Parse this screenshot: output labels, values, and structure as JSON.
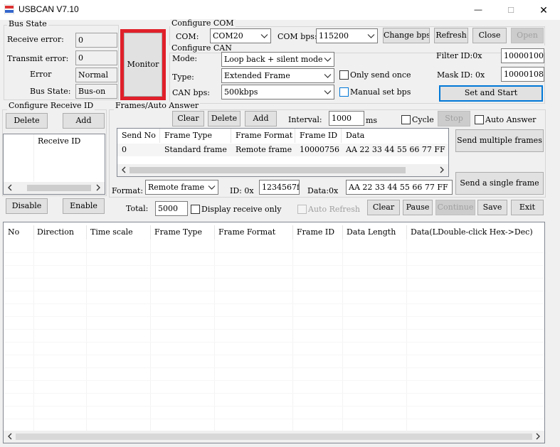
{
  "window": {
    "title": "USBCAN V7.10",
    "controls": {
      "minimize": "—",
      "maximize": "☐",
      "close": "✕"
    }
  },
  "bus_state": {
    "group_title": "Bus State",
    "receive_error_label": "Receive error:",
    "receive_error_value": "0",
    "transmit_error_label": "Transmit error:",
    "transmit_error_value": "0",
    "error_label": "Error",
    "error_value": "Normal",
    "bus_state_label": "Bus State:",
    "bus_state_value": "Bus-on"
  },
  "monitor_button": {
    "label": "Monitor",
    "highlight_color": "#e0202a"
  },
  "configure_com": {
    "group_title": "Configure COM",
    "com_label": "COM:",
    "com_value": "COM20",
    "bps_label": "COM bps:",
    "bps_value": "115200",
    "change_bps": "Change bps",
    "refresh": "Refresh",
    "close": "Close",
    "open": "Open"
  },
  "configure_can": {
    "group_title": "Configure CAN",
    "mode_label": "Mode:",
    "mode_value": "Loop back + silent mode",
    "type_label": "Type:",
    "type_value": "Extended Frame",
    "only_send_once": "Only send once",
    "bps_label": "CAN bps:",
    "bps_value": "500kbps",
    "manual_set_bps": "Manual set bps",
    "filter_label": "Filter ID:0x",
    "filter_value": "10000100",
    "mask_label": "Mask ID:  0x",
    "mask_value": "10000108",
    "set_and_start": "Set and Start"
  },
  "receive_id": {
    "group_title": "Configure Receive ID",
    "delete": "Delete",
    "add": "Add",
    "column": "Receive ID",
    "disable": "Disable",
    "enable": "Enable"
  },
  "frames": {
    "group_title": "Frames/Auto Answer",
    "clear": "Clear",
    "delete": "Delete",
    "add": "Add",
    "interval_label": "Interval:",
    "interval_value": "1000",
    "interval_unit": "ms",
    "cycle": "Cycle",
    "stop": "Stop",
    "auto_answer": "Auto Answer",
    "columns": [
      "Send No",
      "Frame Type",
      "Frame Format",
      "Frame ID",
      "Data"
    ],
    "rows": [
      [
        "0",
        "Standard frame",
        "Remote frame",
        "10000756",
        "AA 22 33 44 55 66 77 FF"
      ]
    ],
    "send_multiple": "Send multiple frames",
    "send_single": "Send a single frame",
    "format_label": "Format:",
    "format_value": "Remote frame",
    "id_label": "ID: 0x",
    "id_value": "1234567f",
    "data_label": "Data:0x",
    "data_value": "AA 22 33 44 55 66 77 FF"
  },
  "controls_row": {
    "total_label": "Total:",
    "total_value": "5000",
    "display_receive_only": "Display receive only",
    "auto_refresh": "Auto Refresh",
    "clear": "Clear",
    "pause": "Pause",
    "continue": "Continue",
    "save": "Save",
    "exit": "Exit"
  },
  "log_table": {
    "columns": [
      "No",
      "Direction",
      "Time scale",
      "Frame Type",
      "Frame Format",
      "Frame ID",
      "Data Length",
      "Data(LDouble-click Hex->Dec)"
    ]
  }
}
